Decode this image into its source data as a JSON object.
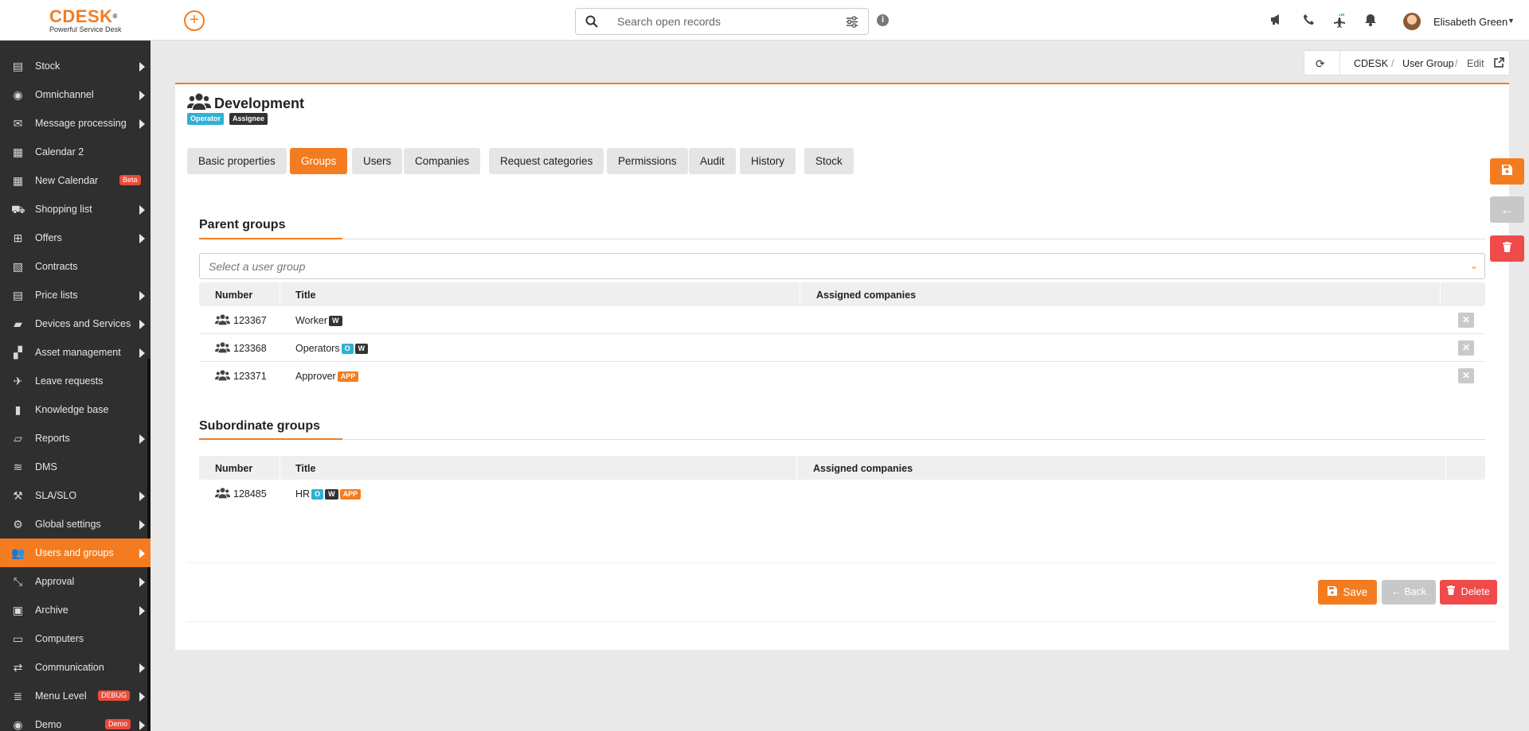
{
  "app": {
    "logo": "CDESK",
    "logo_mark": "®",
    "tagline": "Powerful Service Desk",
    "add_label": "+",
    "search_placeholder": "Search open records",
    "info_label": "i",
    "user_name": "Elisabeth Green",
    "accent_color": "#f47c20"
  },
  "top_icons": [
    "megaphone-icon",
    "phone-icon",
    "airplane-icon",
    "bell-icon"
  ],
  "sidebar": {
    "items": [
      {
        "label": "Stock",
        "icon": "box-icon",
        "arrow": true
      },
      {
        "label": "Omnichannel",
        "icon": "chat-icon",
        "arrow": true
      },
      {
        "label": "Message processing",
        "icon": "envelope-icon",
        "arrow": true
      },
      {
        "label": "Calendar 2",
        "icon": "calendar-icon",
        "arrow": false
      },
      {
        "label": "New Calendar",
        "icon": "calendar-icon",
        "arrow": false,
        "badge": "Beta"
      },
      {
        "label": "Shopping list",
        "icon": "cart-icon",
        "arrow": true
      },
      {
        "label": "Offers",
        "icon": "gift-icon",
        "arrow": true
      },
      {
        "label": "Contracts",
        "icon": "contract-icon",
        "arrow": false
      },
      {
        "label": "Price lists",
        "icon": "pricelist-icon",
        "arrow": true
      },
      {
        "label": "Devices and Services",
        "icon": "folder-icon",
        "arrow": true
      },
      {
        "label": "Asset management",
        "icon": "asset-icon",
        "arrow": true
      },
      {
        "label": "Leave requests",
        "icon": "plane-icon",
        "arrow": false
      },
      {
        "label": "Knowledge base",
        "icon": "book-icon",
        "arrow": false
      },
      {
        "label": "Reports",
        "icon": "folder-open-icon",
        "arrow": true
      },
      {
        "label": "DMS",
        "icon": "database-icon",
        "arrow": false
      },
      {
        "label": "SLA/SLO",
        "icon": "gavel-icon",
        "arrow": true
      },
      {
        "label": "Global settings",
        "icon": "cogs-icon",
        "arrow": true
      },
      {
        "label": "Users and groups",
        "icon": "users-icon",
        "arrow": true,
        "active": true
      },
      {
        "label": "Approval",
        "icon": "compress-icon",
        "arrow": true
      },
      {
        "label": "Archive",
        "icon": "archive-icon",
        "arrow": true
      },
      {
        "label": "Computers",
        "icon": "laptop-icon",
        "arrow": false
      },
      {
        "label": "Communication",
        "icon": "exchange-icon",
        "arrow": true
      },
      {
        "label": "Menu Level",
        "icon": "list-icon",
        "arrow": true,
        "badge": "DEBUG"
      },
      {
        "label": "Demo",
        "icon": "eye-icon",
        "arrow": true,
        "badge": "Demo"
      }
    ]
  },
  "breadcrumb": {
    "items": [
      "CDESK",
      "User Group",
      "Edit"
    ]
  },
  "record": {
    "title": "Development",
    "chips": [
      {
        "label": "Operator",
        "color": "#2fb0d6"
      },
      {
        "label": "Assignee",
        "color": "#333333"
      }
    ]
  },
  "tabs": [
    "Basic properties",
    "Groups",
    "Users",
    "Companies",
    "Request categories",
    "Permissions",
    "Audit",
    "History",
    "Stock"
  ],
  "active_tab": "Groups",
  "parent_groups": {
    "title": "Parent groups",
    "select_placeholder": "Select a user group",
    "columns": [
      "Number",
      "Title",
      "Assigned companies"
    ],
    "rows": [
      {
        "number": "123367",
        "title": "Worker",
        "tags": [
          "W"
        ]
      },
      {
        "number": "123368",
        "title": "Operators",
        "tags": [
          "O",
          "W"
        ]
      },
      {
        "number": "123371",
        "title": "Approver",
        "tags": [
          "APP"
        ]
      }
    ]
  },
  "subordinate_groups": {
    "title": "Subordinate groups",
    "columns": [
      "Number",
      "Title",
      "Assigned companies"
    ],
    "rows": [
      {
        "number": "128485",
        "title": "HR",
        "tags": [
          "O",
          "W",
          "APP"
        ]
      }
    ]
  },
  "actions": {
    "save": "Save",
    "back": "Back",
    "delete": "Delete",
    "save_color": "#f47c20",
    "back_color": "#c8c8c8",
    "delete_color": "#ef4b4b"
  }
}
